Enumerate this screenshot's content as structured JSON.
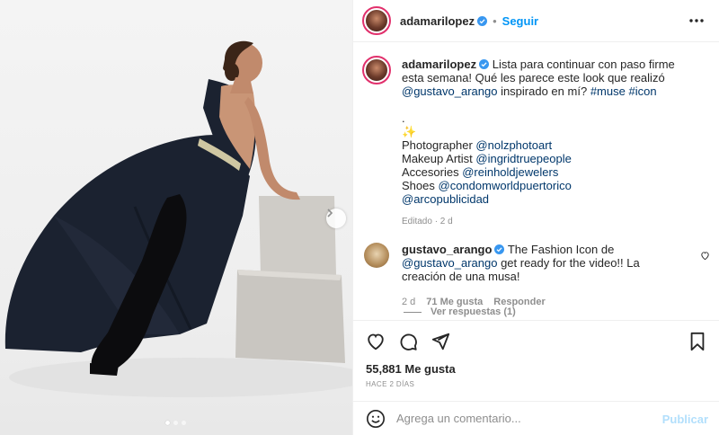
{
  "post": {
    "username": "adamarilopez",
    "follow_label": "Seguir",
    "more_icon": "more-horizontal-icon"
  },
  "caption": {
    "username": "adamarilopez",
    "text_1": "Lista para continuar con paso firme esta semana! Qué les parece este look que realizó",
    "mention_1": "@gustavo_arango",
    "text_2": "inspirado en mí?",
    "hashtag_1": "#muse",
    "hashtag_2": "#icon",
    "dot": ".",
    "sparkle": "✨",
    "photographer_label": "Photographer",
    "photographer": "@nolzphotoart",
    "makeup_label": "Makeup Artist",
    "makeup": "@ingridtruepeople",
    "accessories_label": "Accesories",
    "accessories": "@reinholdjewelers",
    "shoes_label": "Shoes",
    "shoes": "@condomworldpuertorico",
    "agency": "@arcopublicidad",
    "edited": "Editado · 2 d"
  },
  "comment": {
    "username": "gustavo_arango",
    "text_1": "The Fashion Icon de",
    "mention": "@gustavo_arango",
    "text_2": "get ready for the video!! La creación de una musa!",
    "time": "2 d",
    "likes": "71 Me gusta",
    "reply": "Responder",
    "view_replies": "Ver respuestas (1)"
  },
  "actions": {
    "likes": "55,881 Me gusta",
    "time_ago": "HACE 2 DÍAS"
  },
  "add_comment": {
    "placeholder": "Agrega un comentario...",
    "publish": "Publicar"
  },
  "colors": {
    "link": "#00376b",
    "accent": "#0095f6",
    "muted": "#8e8e8e",
    "publish_disabled": "#b2dffc",
    "verified": "#3897f0"
  },
  "carousel": {
    "slides": 3,
    "active": 1
  }
}
